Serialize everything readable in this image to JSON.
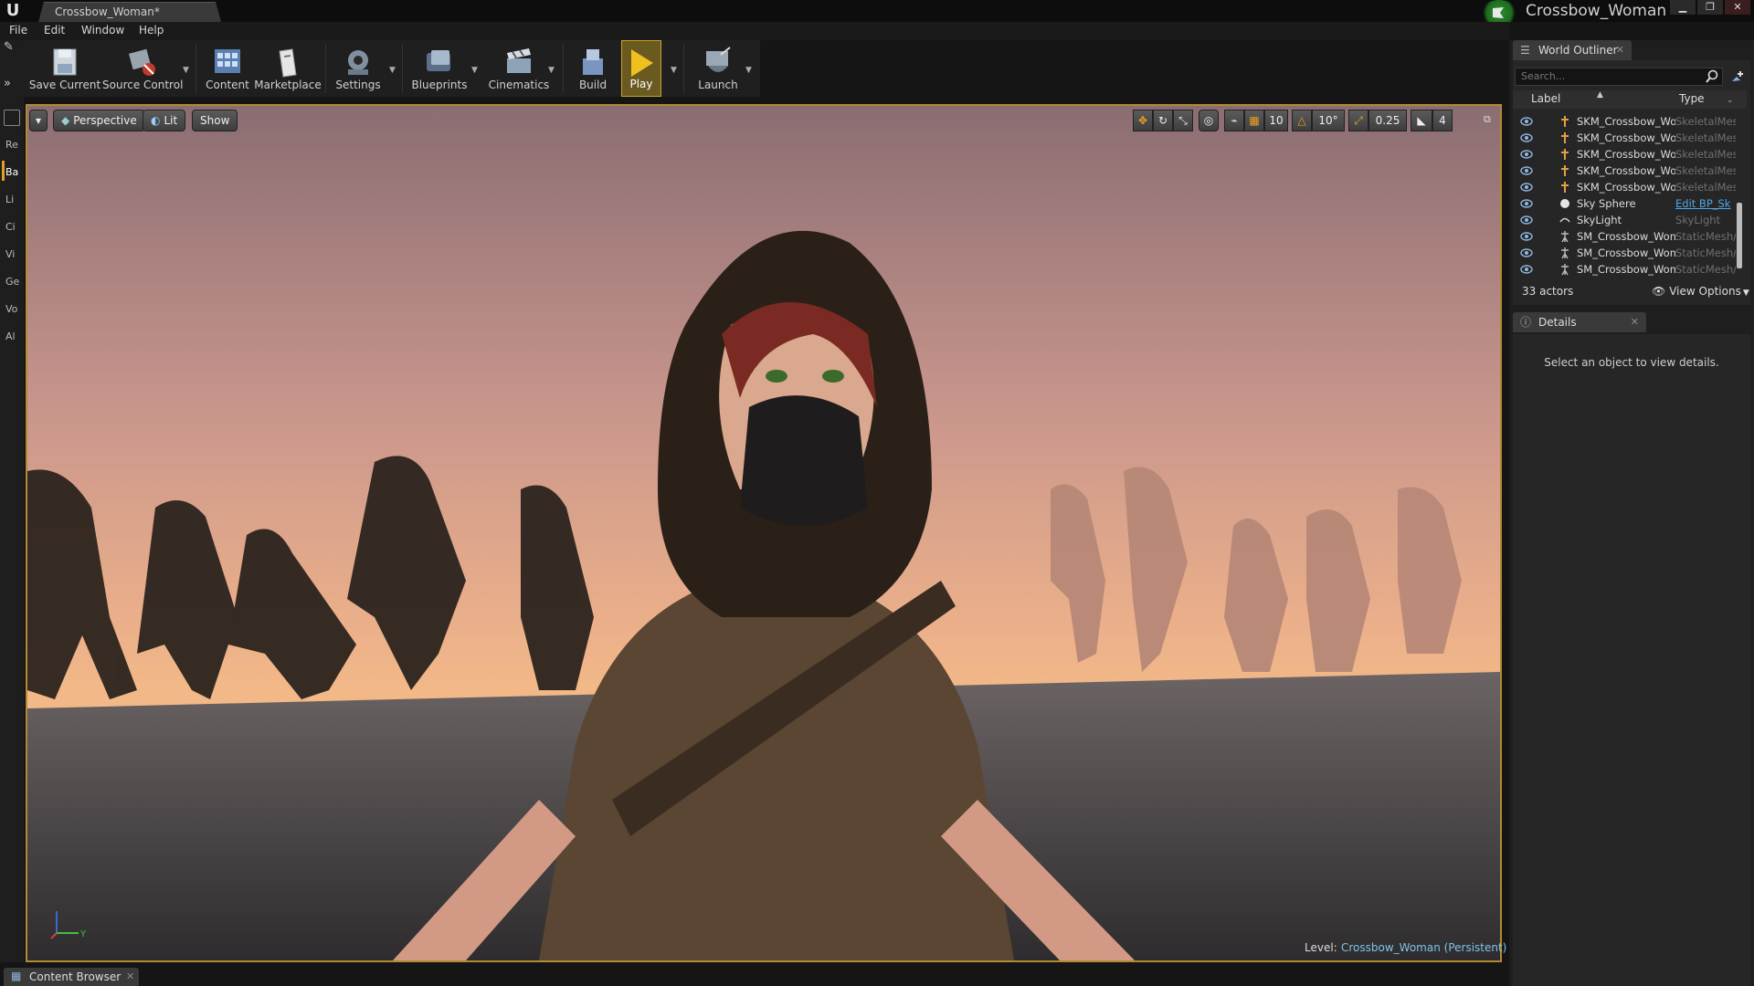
{
  "window": {
    "doc_tab": "Crossbow_Woman*",
    "project_name": "Crossbow_Woman",
    "buttons": {
      "minimize": "▁",
      "maximize": "❐",
      "close": "✕"
    }
  },
  "menu": [
    "File",
    "Edit",
    "Window",
    "Help"
  ],
  "toolbar": {
    "save_current": "Save Current",
    "source_control": "Source Control",
    "content": "Content",
    "marketplace": "Marketplace",
    "settings": "Settings",
    "blueprints": "Blueprints",
    "cinematics": "Cinematics",
    "build": "Build",
    "play": "Play",
    "launch": "Launch"
  },
  "mode_tabs": [
    "Re",
    "Ba",
    "Li",
    "Ci",
    "Vi",
    "Ge",
    "Vo",
    "Al"
  ],
  "viewport": {
    "perspective": "Perspective",
    "lit": "Lit",
    "show": "Show",
    "grid_snap": "10",
    "rotation_snap": "10°",
    "scale_snap": "0.25",
    "camera_speed": "4",
    "level_label": "Level:",
    "level_value": "Crossbow_Woman (Persistent)"
  },
  "world_outliner": {
    "tab": "World Outliner",
    "search_placeholder": "Search...",
    "col_label": "Label",
    "col_type": "Type",
    "rows": [
      {
        "label": "SKM_Crossbow_Wo",
        "type": "SkeletalMes"
      },
      {
        "label": "SKM_Crossbow_Wo",
        "type": "SkeletalMes"
      },
      {
        "label": "SKM_Crossbow_Wo",
        "type": "SkeletalMes"
      },
      {
        "label": "SKM_Crossbow_Wo",
        "type": "SkeletalMes"
      },
      {
        "label": "SKM_Crossbow_Wo",
        "type": "SkeletalMes"
      },
      {
        "label": "Sky Sphere",
        "type": "Edit BP_Sk"
      },
      {
        "label": "SkyLight",
        "type": "SkyLight"
      },
      {
        "label": "SM_Crossbow_Wom",
        "type": "StaticMesh/"
      },
      {
        "label": "SM_Crossbow_Wom",
        "type": "StaticMesh/"
      },
      {
        "label": "SM_Crossbow_Wom",
        "type": "StaticMesh/"
      }
    ],
    "actors_count": "33 actors",
    "view_options": "View Options"
  },
  "details": {
    "tab": "Details",
    "message": "Select an object to view details."
  },
  "bottom": {
    "content_browser": "Content Browser"
  },
  "colors": {
    "accent_gold": "#b28a32",
    "play_yellow": "#f0c020",
    "link_blue": "#4ea6e8",
    "level_blue": "#7fc4e6"
  }
}
